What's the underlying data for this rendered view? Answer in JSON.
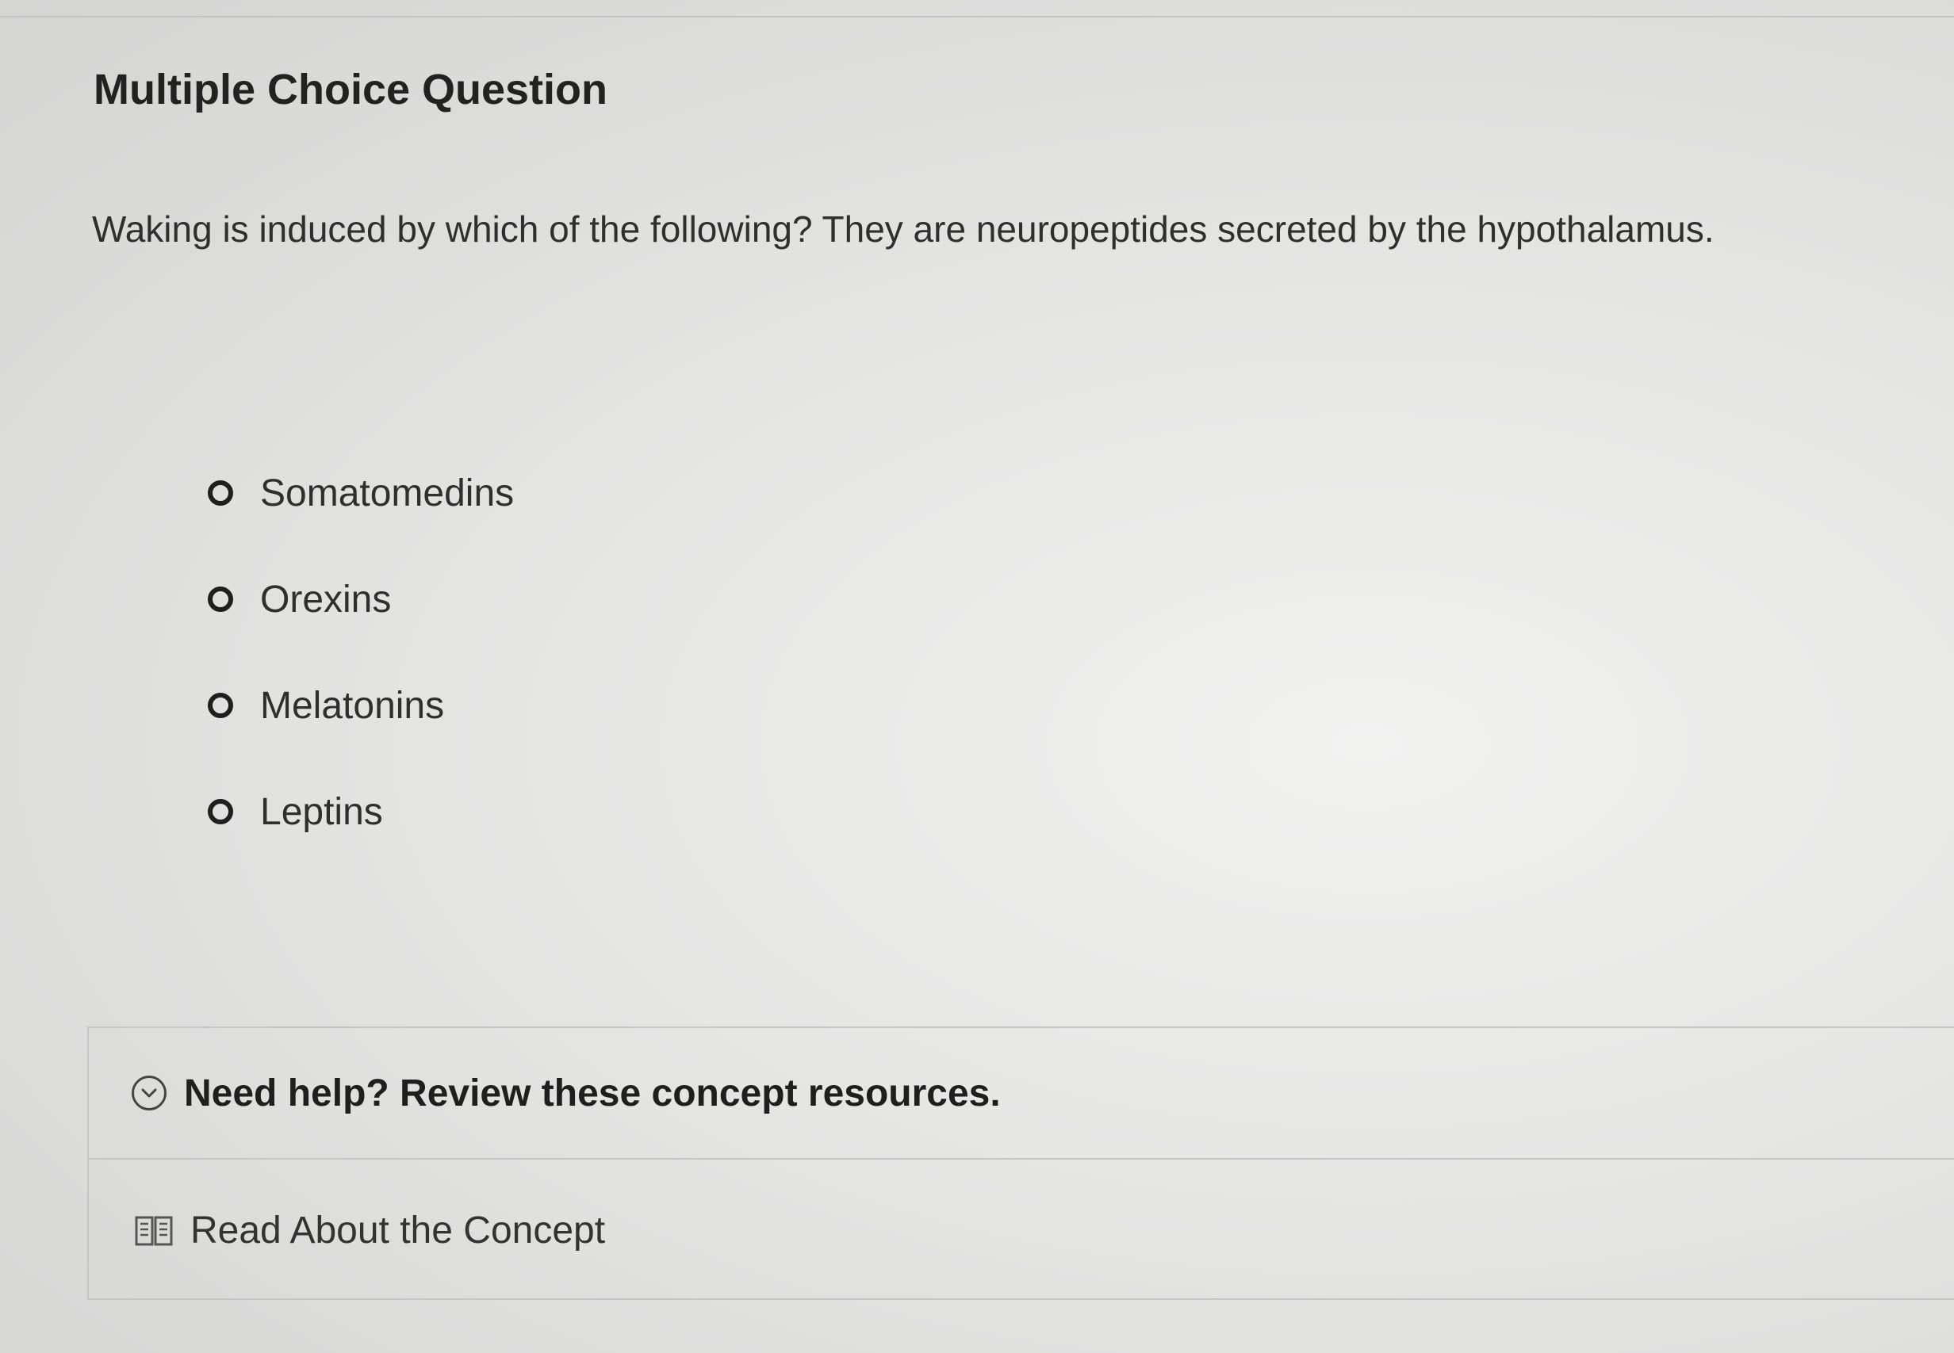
{
  "page": {
    "title": "Multiple Choice Question"
  },
  "question": {
    "text": "Waking is induced by which of the following? They are neuropeptides secreted by the hypothalamus.",
    "options": [
      {
        "label": "Somatomedins"
      },
      {
        "label": "Orexins"
      },
      {
        "label": "Melatonins"
      },
      {
        "label": "Leptins"
      }
    ]
  },
  "help": {
    "header": "Need help? Review these concept resources.",
    "header_icon": "chevron-down-circle-icon",
    "link_label": "Read About the Concept",
    "link_icon": "book-icon"
  }
}
